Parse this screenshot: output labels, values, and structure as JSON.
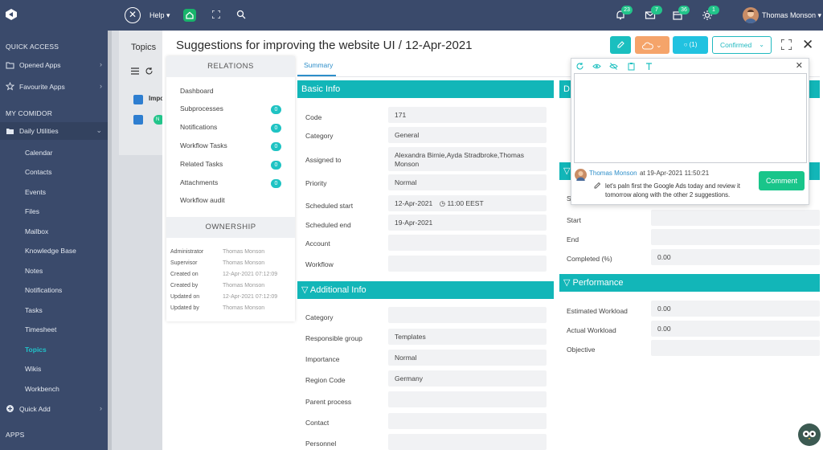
{
  "topbar": {
    "help_label": "Help",
    "badges": {
      "notifications": "23",
      "messages": "7",
      "tasks": "36",
      "alerts": "1"
    },
    "user_name": "Thomas Monson"
  },
  "sidebar": {
    "quick_access": "QUICK ACCESS",
    "opened_apps": "Opened Apps",
    "favourite_apps": "Favourite Apps",
    "my_comidor": "MY COMIDOR",
    "daily_utilities": "Daily Utilities",
    "sub_items": [
      "Calendar",
      "Contacts",
      "Events",
      "Files",
      "Mailbox",
      "Knowledge Base",
      "Notes",
      "Notifications",
      "Tasks",
      "Timesheet",
      "Topics",
      "Wikis",
      "Workbench"
    ],
    "active_item": "Topics",
    "quick_add": "Quick Add",
    "apps": "APPS"
  },
  "background": {
    "title": "Topics",
    "row_label": "Impo",
    "tag": "N"
  },
  "modal": {
    "title": "Suggestions for improving the website UI / 12-Apr-2021",
    "comment_count": "(1)",
    "status": "Confirmed",
    "tab_summary": "Summary"
  },
  "relations": {
    "header": "RELATIONS",
    "items": [
      {
        "label": "Dashboard",
        "count": ""
      },
      {
        "label": "Subprocesses",
        "count": "0"
      },
      {
        "label": "Notifications",
        "count": "0"
      },
      {
        "label": "Workflow Tasks",
        "count": "0"
      },
      {
        "label": "Related Tasks",
        "count": "0"
      },
      {
        "label": "Attachments",
        "count": "0"
      },
      {
        "label": "Workflow audit",
        "count": ""
      }
    ]
  },
  "ownership": {
    "header": "OWNERSHIP",
    "rows": [
      {
        "label": "Administrator",
        "value": "Thomas Monson"
      },
      {
        "label": "Supervisor",
        "value": "Thomas Monson"
      },
      {
        "label": "Created on",
        "value": "12-Apr-2021 07:12:09"
      },
      {
        "label": "Created by",
        "value": "Thomas Monson"
      },
      {
        "label": "Updated on",
        "value": "12-Apr-2021 07:12:09"
      },
      {
        "label": "Updated by",
        "value": "Thomas Monson"
      }
    ]
  },
  "basic_info": {
    "header": "Basic Info",
    "code_label": "Code",
    "code": "171",
    "category_label": "Category",
    "category": "General",
    "assigned_label": "Assigned to",
    "assigned": "Alexandra Birnie,Ayda Stradbroke,Thomas Monson",
    "priority_label": "Priority",
    "priority": "Normal",
    "start_label": "Scheduled start",
    "start_date": "12-Apr-2021",
    "start_time": "11:00 EEST",
    "end_label": "Scheduled end",
    "end_date": "19-Apr-2021",
    "account_label": "Account",
    "workflow_label": "Workflow"
  },
  "additional_info": {
    "header": "Additional Info",
    "category_label": "Category",
    "group_label": "Responsible group",
    "group": "Templates",
    "importance_label": "Importance",
    "importance": "Normal",
    "region_label": "Region Code",
    "region": "Germany",
    "parent_label": "Parent process",
    "contact_label": "Contact",
    "personnel_label": "Personnel"
  },
  "right_panel": {
    "head_letter": "D",
    "start_label": "Start",
    "end_label": "End",
    "completed_label": "Completed (%)",
    "completed": "0.00",
    "s_letter": "S"
  },
  "performance": {
    "header": "Performance",
    "estimated_label": "Estimated Workload",
    "estimated": "0.00",
    "actual_label": "Actual Workload",
    "actual": "0.00",
    "objective_label": "Objective"
  },
  "comment": {
    "author": "Thomas Monson",
    "date": "at 19-Apr-2021 11:50:21",
    "body": "let's paln first the Google Ads today and review it tomorrow along with the other 2 suggestions.",
    "button": "Comment"
  }
}
